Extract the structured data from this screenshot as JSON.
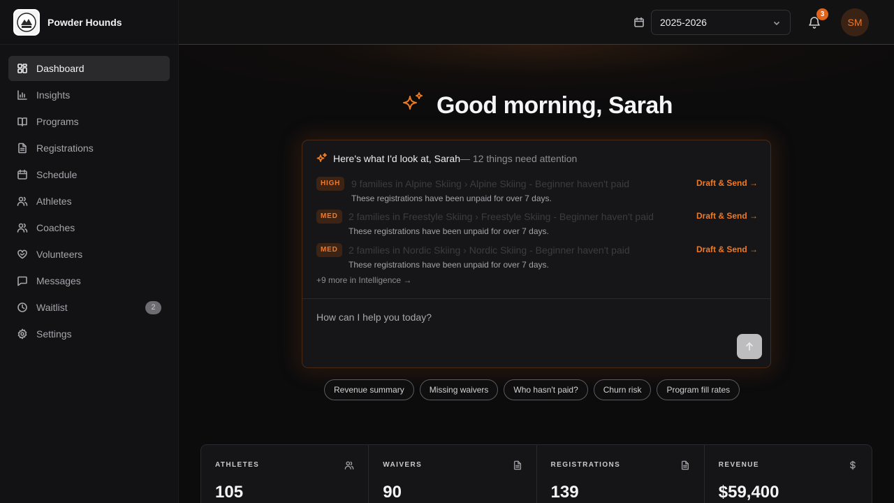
{
  "app": {
    "name": "Powder Hounds",
    "logo_text": "POWDER HOUNDS"
  },
  "sidebar": {
    "items": [
      {
        "label": "Dashboard",
        "icon": "dashboard-icon",
        "active": true
      },
      {
        "label": "Insights",
        "icon": "bar-chart-icon"
      },
      {
        "label": "Programs",
        "icon": "book-icon"
      },
      {
        "label": "Registrations",
        "icon": "document-icon"
      },
      {
        "label": "Schedule",
        "icon": "calendar-icon"
      },
      {
        "label": "Athletes",
        "icon": "users-icon"
      },
      {
        "label": "Coaches",
        "icon": "user-group-icon"
      },
      {
        "label": "Volunteers",
        "icon": "heart-handshake-icon"
      },
      {
        "label": "Messages",
        "icon": "message-icon"
      },
      {
        "label": "Waitlist",
        "icon": "clock-icon",
        "badge": "2"
      },
      {
        "label": "Settings",
        "icon": "gear-icon"
      }
    ]
  },
  "header": {
    "season": "2025-2026",
    "notification_count": "3",
    "avatar_initials": "SM"
  },
  "main": {
    "greeting": "Good morning, Sarah",
    "panel": {
      "lead": "Here's what I'd look at, Sarah",
      "summary": " — 12 things need attention",
      "alerts": [
        {
          "level": "HIGH",
          "title": "9 families in Alpine Skiing › Alpine Skiing - Beginner haven't paid",
          "subtitle": "These registrations have been unpaid for over 7 days.",
          "action": "Draft & Send →"
        },
        {
          "level": "MED",
          "title": "2 families in Freestyle Skiing › Freestyle Skiing - Beginner haven't paid",
          "subtitle": "These registrations have been unpaid for over 7 days.",
          "action": "Draft & Send →"
        },
        {
          "level": "MED",
          "title": "2 families in Nordic Skiing › Nordic Skiing - Beginner haven't paid",
          "subtitle": "These registrations have been unpaid for over 7 days.",
          "action": "Draft & Send →"
        }
      ],
      "more_link": "+9 more in Intelligence →",
      "prompt_placeholder": "How can I help you today?"
    },
    "chips": [
      "Revenue summary",
      "Missing waivers",
      "Who hasn't paid?",
      "Churn risk",
      "Program fill rates"
    ],
    "stats": [
      {
        "label": "ATHLETES",
        "value": "105",
        "icon": "users-icon"
      },
      {
        "label": "WAIVERS",
        "value": "90",
        "icon": "document-icon"
      },
      {
        "label": "REGISTRATIONS",
        "value": "139",
        "icon": "document-icon"
      },
      {
        "label": "REVENUE",
        "value": "$59,400",
        "icon": "dollar-icon"
      }
    ]
  },
  "colors": {
    "accent": "#ef7a26",
    "background": "#0c0c0d",
    "sidebar": "#121214"
  }
}
